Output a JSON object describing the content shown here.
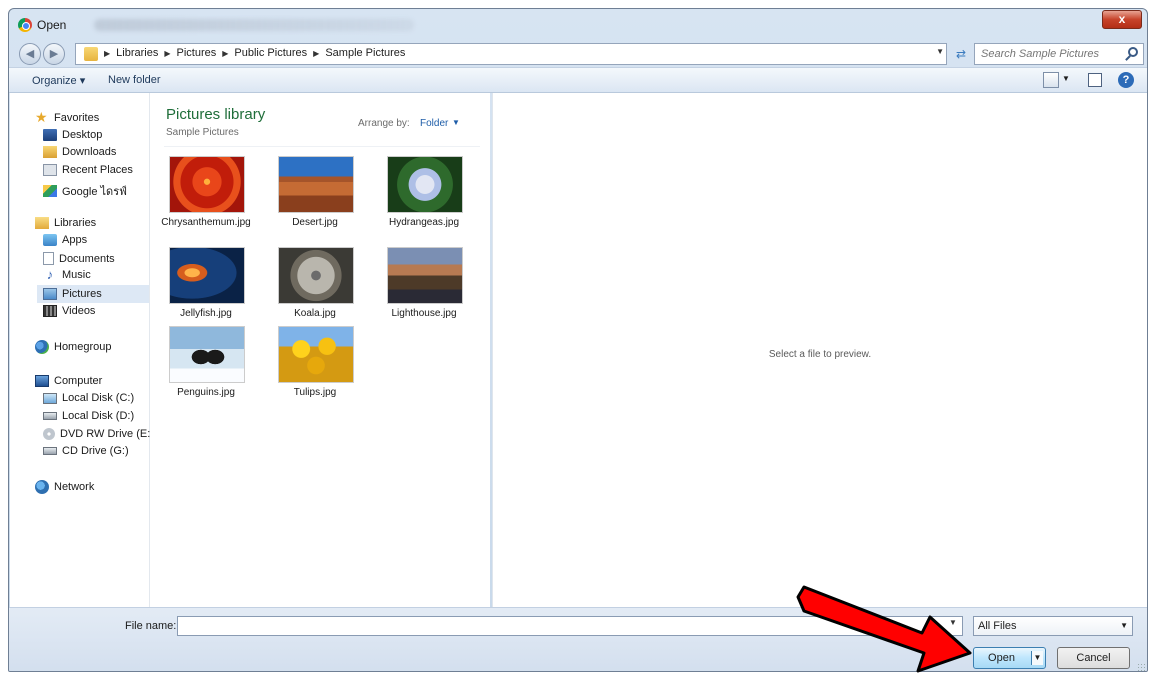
{
  "window": {
    "title": "Open",
    "close_glyph": "x"
  },
  "address": {
    "breadcrumbs": [
      "Libraries",
      "Pictures",
      "Public Pictures",
      "Sample Pictures"
    ],
    "search_placeholder": "Search Sample Pictures"
  },
  "toolbar": {
    "organize_label": "Organize ▾",
    "new_folder_label": "New folder",
    "help_glyph": "?"
  },
  "nav": {
    "favorites": "Favorites",
    "desktop": "Desktop",
    "downloads": "Downloads",
    "recent_places": "Recent Places",
    "google_drive": "Google ไดรฟ์",
    "libraries": "Libraries",
    "apps": "Apps",
    "documents": "Documents",
    "music": "Music",
    "pictures": "Pictures",
    "videos": "Videos",
    "homegroup": "Homegroup",
    "computer": "Computer",
    "local_c": "Local Disk (C:)",
    "local_d": "Local Disk (D:)",
    "dvd": "DVD RW Drive (E:) N",
    "cd": "CD Drive (G:)",
    "network": "Network"
  },
  "library": {
    "title": "Pictures library",
    "subtitle": "Sample Pictures",
    "arrange_label": "Arrange by:",
    "arrange_value": "Folder"
  },
  "files": [
    {
      "name": "Chrysanthemum.jpg"
    },
    {
      "name": "Desert.jpg"
    },
    {
      "name": "Hydrangeas.jpg"
    },
    {
      "name": "Jellyfish.jpg"
    },
    {
      "name": "Koala.jpg"
    },
    {
      "name": "Lighthouse.jpg"
    },
    {
      "name": "Penguins.jpg"
    },
    {
      "name": "Tulips.jpg"
    }
  ],
  "preview": {
    "message": "Select a file to preview."
  },
  "bottom": {
    "file_name_label": "File name:",
    "file_name_value": "",
    "filter_value": "All Files",
    "open_label": "Open",
    "cancel_label": "Cancel"
  },
  "colors": {
    "arrow_fill": "#ff0000",
    "arrow_stroke": "#000000",
    "library_title": "#1f6e3a"
  }
}
